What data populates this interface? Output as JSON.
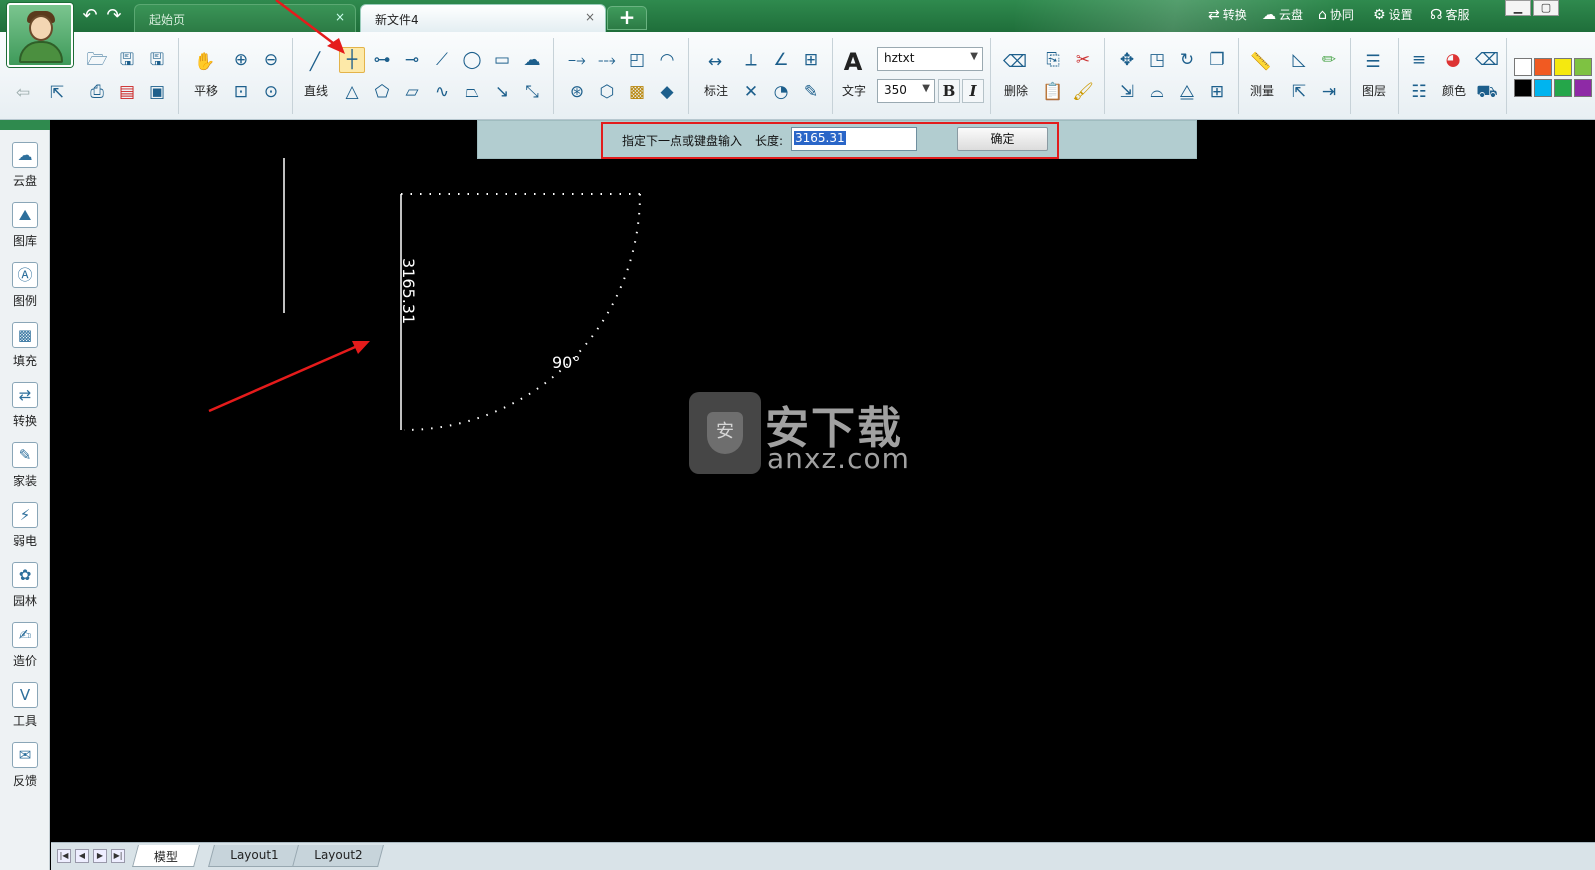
{
  "tabs": [
    {
      "label": "起始页",
      "close": "×",
      "active": false
    },
    {
      "label": "新文件4",
      "close": "×",
      "active": true
    }
  ],
  "new_tab": "+",
  "top_right": [
    {
      "icon": "convert-icon",
      "label": "转换"
    },
    {
      "icon": "cloud-icon",
      "label": "云盘"
    },
    {
      "icon": "collab-icon",
      "label": "协同"
    },
    {
      "icon": "gear-icon",
      "label": "设置"
    },
    {
      "icon": "headset-icon",
      "label": "客服"
    }
  ],
  "ribbon": {
    "pan_label": "平移",
    "line_label": "直线",
    "dimension_label": "标注",
    "text_label": "文字",
    "font_name": "hztxt",
    "font_size": "350",
    "bold": "B",
    "italic": "I",
    "delete_label": "删除",
    "measure_label": "测量",
    "layer_label": "图层",
    "color_label": "颜色",
    "text_glyph": "A"
  },
  "colors": {
    "palette_row1": [
      "#ffffff",
      "#f15a22",
      "#f5e90f",
      "#7ec242"
    ],
    "palette_row2": [
      "#000000",
      "#00b4ef",
      "#25a64a",
      "#8e2aa6"
    ],
    "accent": "#2f8a4e",
    "highlight_box": "#e21c1c"
  },
  "sidebar": [
    {
      "icon": "cloud-icon",
      "label": "云盘"
    },
    {
      "icon": "gallery-icon",
      "label": "图库"
    },
    {
      "icon": "legend-icon",
      "label": "图例"
    },
    {
      "icon": "hatch-icon",
      "label": "填充"
    },
    {
      "icon": "convert-icon",
      "label": "转换"
    },
    {
      "icon": "home-design-icon",
      "label": "家装"
    },
    {
      "icon": "low-voltage-icon",
      "label": "弱电"
    },
    {
      "icon": "garden-icon",
      "label": "园林"
    },
    {
      "icon": "cost-icon",
      "label": "造价"
    },
    {
      "icon": "tools-icon",
      "label": "工具"
    },
    {
      "icon": "feedback-icon",
      "label": "反馈"
    }
  ],
  "command": {
    "prompt": "指定下一点或键盘输入",
    "length_label": "长度:",
    "length_value": "3165.31",
    "ok_label": "确定"
  },
  "drawing": {
    "dimension_text": "3165.31",
    "angle_text": "90°"
  },
  "watermark": {
    "shield_glyph": "安",
    "text_cn": "安下载",
    "text_en": "anxz.com"
  },
  "layout_tabs": [
    "模型",
    "Layout1",
    "Layout2"
  ]
}
